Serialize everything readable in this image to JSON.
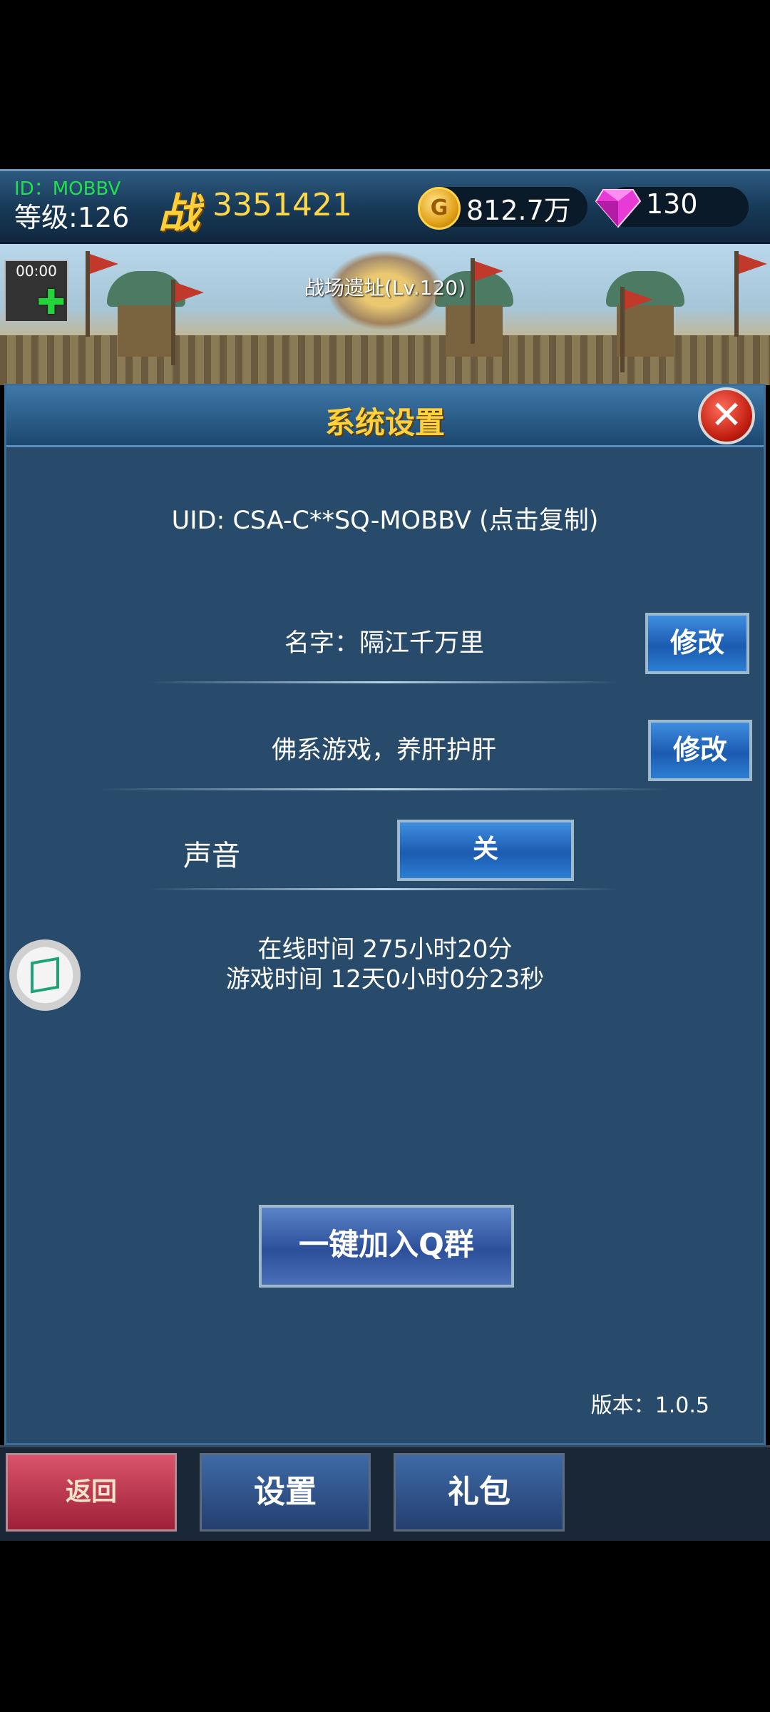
{
  "hud": {
    "id_text": "ID：MOBBV",
    "level_text": "等级:126",
    "zhan_label": "战",
    "power": "3351421",
    "coin_letter": "G",
    "gold": "812.7万",
    "gems": "130"
  },
  "scene": {
    "timer": "00:00",
    "location": "战场遗址(Lv.120)"
  },
  "panel": {
    "title": "系统设置",
    "close_symbol": "✕",
    "uid": "UID: CSA-C**SQ-MOBBV (点击复制)",
    "name_label": "名字：隔江千万里",
    "name_edit": "修改",
    "signature": "佛系游戏，养肝护肝",
    "signature_edit": "修改",
    "sound_label": "声音",
    "sound_value": "关",
    "online_time": "在线时间 275小时20分",
    "game_time": "游戏时间 12天0小时0分23秒",
    "join_group": "一键加入Q群",
    "version": "版本：1.0.5"
  },
  "bottom": {
    "back": "返回",
    "settings": "设置",
    "gift": "礼包"
  }
}
